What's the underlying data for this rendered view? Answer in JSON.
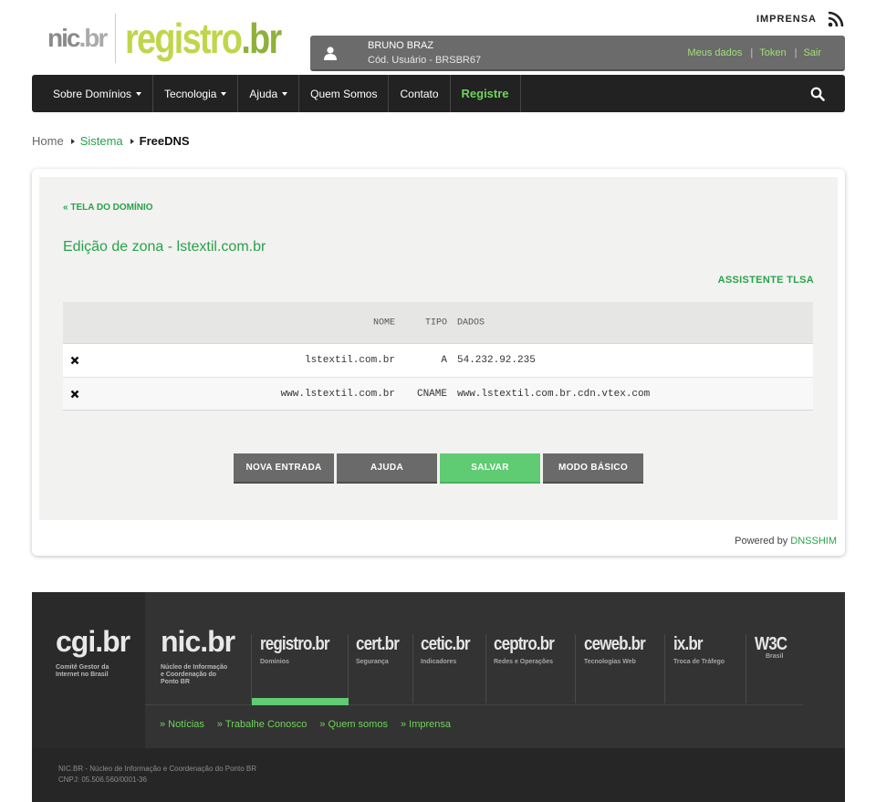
{
  "header": {
    "logo_nic": "nic",
    "logo_nic_br": ".br",
    "logo_registro": "registro",
    "logo_registro_br": ".br",
    "imprensa_label": "IMPRENSA",
    "rss_icon": "rss-icon"
  },
  "user": {
    "name": "BRUNO BRAZ",
    "code": "Cód. Usuário - BRSBR67",
    "links": [
      "Meus dados",
      "Token",
      "Sair"
    ]
  },
  "nav": {
    "items": [
      {
        "label": "Sobre Domínios",
        "caret": true
      },
      {
        "label": "Tecnologia",
        "caret": true
      },
      {
        "label": "Ajuda",
        "caret": true
      },
      {
        "label": "Quem Somos",
        "caret": false
      },
      {
        "label": "Contato",
        "caret": false
      },
      {
        "label": "Registre",
        "caret": false
      }
    ]
  },
  "breadcrumb": {
    "home": "Home",
    "section": "Sistema",
    "current": "FreeDNS"
  },
  "content": {
    "back_link": "« TELA DO DOMÍNIO",
    "title": "Edição de zona - lstextil.com.br",
    "tlsa_link": "ASSISTENTE TLSA",
    "table": {
      "headers": {
        "name": "NOME",
        "type": "TIPO",
        "data": "DADOS"
      },
      "rows": [
        {
          "name": "lstextil.com.br",
          "type": "A",
          "data": "54.232.92.235"
        },
        {
          "name": "www.lstextil.com.br",
          "type": "CNAME",
          "data": "www.lstextil.com.br.cdn.vtex.com"
        }
      ]
    },
    "buttons": {
      "new_entry": "NOVA ENTRADA",
      "help": "AJUDA",
      "save": "SALVAR",
      "basic_mode": "MODO BÁSICO"
    },
    "powered_prefix": "Powered by ",
    "powered_brand": "DNSSHIM"
  },
  "footer": {
    "cgi": {
      "name": "cgi.br",
      "sub1": "Comitê Gestor da",
      "sub2": "Internet no Brasil"
    },
    "nic": {
      "name": "nic.br",
      "sub1": "Núcleo de Informação",
      "sub2": "e Coordenação do",
      "sub3": "Ponto BR"
    },
    "brands": [
      {
        "name": "registro.br",
        "sub": "Domínios"
      },
      {
        "name": "cert.br",
        "sub": "Segurança"
      },
      {
        "name": "cetic.br",
        "sub": "Indicadores"
      },
      {
        "name": "ceptro.br",
        "sub": "Redes e Operações"
      },
      {
        "name": "ceweb.br",
        "sub": "Tecnologias Web"
      },
      {
        "name": "ix.br",
        "sub": "Troca de Tráfego"
      },
      {
        "name": "W3C",
        "sub": "Brasil"
      }
    ],
    "links": [
      "» Notícias",
      "» Trabalhe Conosco",
      "» Quem somos",
      "» Imprensa"
    ],
    "org_line1": "NIC.BR - Núcleo de Informação e Coordenação do Ponto BR",
    "org_line2": "CNPJ: 05.506.560/0001-36"
  },
  "colors": {
    "accent_green": "#2aa14a",
    "button_green": "#5fcb72",
    "nav_bg": "#222222",
    "footer_bg": "#333333"
  }
}
